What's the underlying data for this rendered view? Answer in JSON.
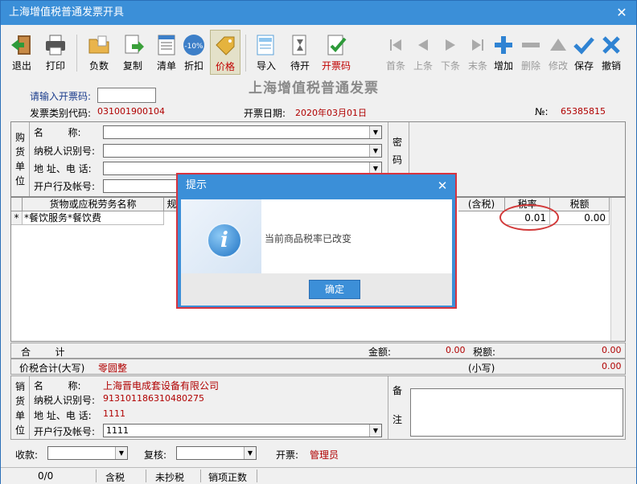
{
  "window": {
    "title": "上海增值税普通发票开具",
    "close": "✕"
  },
  "toolbar": {
    "exit": "退出",
    "print": "打印",
    "negative": "负数",
    "copy": "复制",
    "list": "清单",
    "discount": "折扣",
    "discount_badge": "-10%",
    "price": "价格",
    "import": "导入",
    "pending": "待开",
    "issue": "开票码",
    "first": "首条",
    "prev": "上条",
    "next": "下条",
    "last": "末条",
    "add": "增加",
    "delete": "删除",
    "modify": "修改",
    "save": "保存",
    "cancel": "撤销"
  },
  "invoice": {
    "heading": "上海增值税普通发票",
    "code_prompt": "请输入开票码:",
    "type_code_label": "发票类别代码:",
    "type_code": "031001900104",
    "date_label": "开票日期:",
    "date": "2020年03月01日",
    "no_label": "№:",
    "no": "65385815"
  },
  "buyer": {
    "side": "购\n货\n单\n位",
    "name": "名        称:",
    "tax_id": "纳税人识别号:",
    "addr": "地 址、电 话:",
    "bank": "开户行及帐号:",
    "cipher": "密\n码"
  },
  "table": {
    "headers": [
      "货物或应税劳务名称",
      "规",
      "(含税)",
      "税率",
      "税额"
    ],
    "row": {
      "marker": "*",
      "name": "*餐饮服务*餐饮费",
      "rate": "0.01",
      "tax": "0.00"
    }
  },
  "totals": {
    "sum_label": "合        计",
    "amount_label": "金额:",
    "amount": "0.00",
    "tax_label": "税额:",
    "tax": "0.00",
    "total_upper_label": "价税合计(大写)",
    "total_upper": "零圆整",
    "small_label": "(小写)",
    "small": "0.00"
  },
  "seller": {
    "side": "销\n货\n单\n位",
    "name_label": "名        称:",
    "name": "上海晋电成套设备有限公司",
    "tax_id_label": "纳税人识别号:",
    "tax_id": "913101186310480275",
    "addr_label": "地 址、电 话:",
    "addr": "1111",
    "bank_label": "开户行及帐号:",
    "bank": "1111",
    "remark": "备\n\n\n注"
  },
  "footer": {
    "payee": "收款:",
    "reviewer": "复核:",
    "drawer_label": "开票:",
    "drawer": "管理员"
  },
  "status": {
    "count": "0/0",
    "tax_incl": "含税",
    "unsent": "未抄税",
    "item": "销项正数"
  },
  "dialog": {
    "title": "提示",
    "message": "当前商品税率已改变",
    "ok": "确定",
    "close": "✕"
  }
}
